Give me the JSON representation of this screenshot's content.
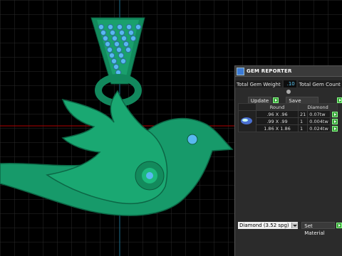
{
  "panel": {
    "title": "GEM REPORTER",
    "total_weight_label": "Total Gem Weight",
    "total_weight_value": ".10",
    "total_count_label": "Total Gem Count"
  },
  "actions": {
    "update_label": "Update",
    "save_report_label": "Save Report"
  },
  "table": {
    "headers": [
      "Round",
      "Diamond"
    ],
    "rows": [
      {
        "size": ".96 X .96",
        "count": "21",
        "weight": "0.07tw"
      },
      {
        "size": ".99 X .99",
        "count": "1",
        "weight": "0.004tw"
      },
      {
        "size": "1.86 X 1.86",
        "count": "1",
        "weight": "0.024tw"
      }
    ]
  },
  "material": {
    "selected": "Diamond   (3.52 spg)",
    "set_label": "Set Material"
  },
  "colors": {
    "viewport_bg": "#000000",
    "grid": "#2a2a2a",
    "model": "#179a6a",
    "gem": "#58b8f0",
    "panel_bg": "#2b2b2b",
    "go_button": "#3aa33a"
  },
  "icons": [
    "gem-thumbnail",
    "go-arrow-icon",
    "dropdown-arrow-icon",
    "app-icon"
  ]
}
